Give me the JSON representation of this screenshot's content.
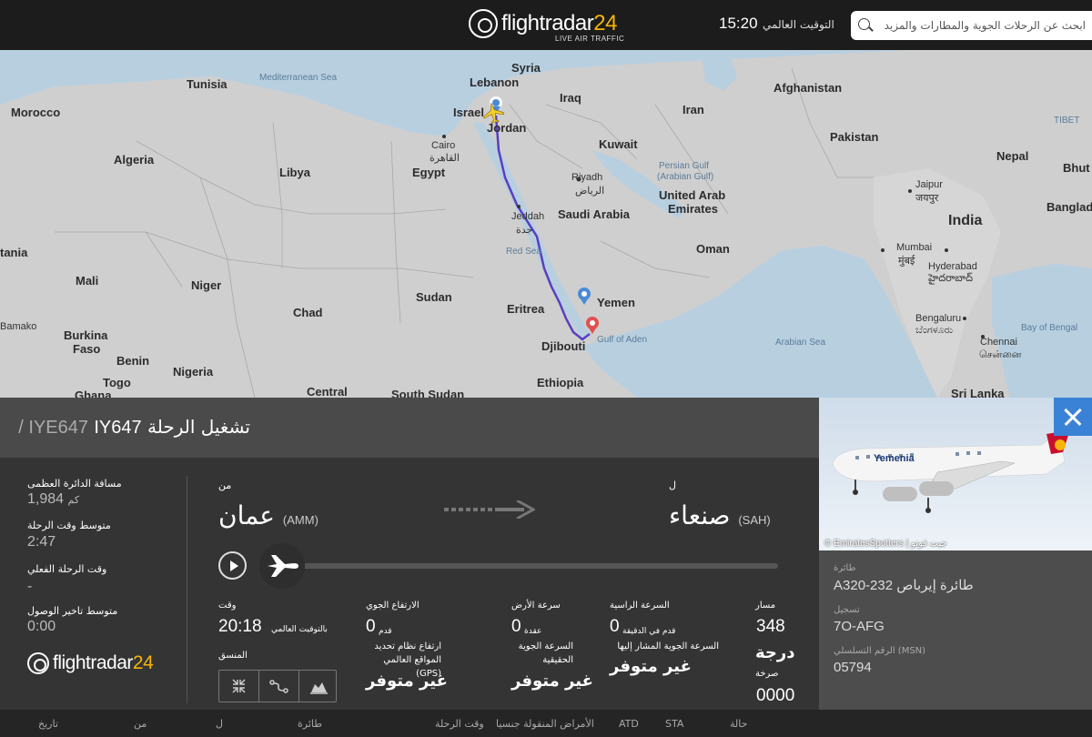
{
  "header": {
    "logo_text": "flightradar",
    "logo_num": "24",
    "logo_sub": "LIVE AIR TRAFFIC",
    "utc_label": "التوقيت العالمي",
    "utc_time": "15:20",
    "search_placeholder": "ابحث عن الرحلات الجوية والمطارات والمزيد"
  },
  "map": {
    "labels": {
      "tunisia": "Tunisia",
      "morocco": "Morocco",
      "algeria": "Algeria",
      "libya": "Libya",
      "egypt": "Egypt",
      "cairo": "Cairo",
      "cairo_ar": "القاهرة",
      "mediterranean": "Mediterranean Sea",
      "syria": "Syria",
      "lebanon": "Lebanon",
      "israel": "Israel",
      "jordan": "Jordan",
      "iraq": "Iraq",
      "iran": "Iran",
      "afghanistan": "Afghanistan",
      "pakistan": "Pakistan",
      "kuwait": "Kuwait",
      "persian_gulf": "Persian Gulf",
      "arabian_gulf": "(Arabian Gulf)",
      "riyadh": "Riyadh",
      "riyadh_ar": "الرياض",
      "saudi": "Saudi Arabia",
      "uae1": "United Arab",
      "uae2": "Emirates",
      "oman": "Oman",
      "jeddah": "Jeddah",
      "jeddah_ar": "جدة",
      "red_sea": "Red Sea",
      "yemen": "Yemen",
      "eritrea": "Eritrea",
      "djibouti": "Djibouti",
      "gulf_aden": "Gulf of Aden",
      "ethiopia": "Ethiopia",
      "sudan": "Sudan",
      "south_sudan": "South Sudan",
      "chad": "Chad",
      "niger": "Niger",
      "mali": "Mali",
      "nigeria": "Nigeria",
      "central": "Central",
      "benin": "Benin",
      "togo": "Togo",
      "ghana": "Ghana",
      "burkina1": "Burkina",
      "burkina2": "Faso",
      "bamako": "Bamako",
      "tania": "tania",
      "nepal": "Nepal",
      "bhutan": "Bhut",
      "tibet": "TIBET",
      "india": "India",
      "jaipur": "Jaipur",
      "jaipur_hi": "जयपुर",
      "mumbai": "Mumbai",
      "mumbai_mr": "मुंबई",
      "hyderabad": "Hyderabad",
      "hyderabad_te": "హైదరాబాద్",
      "bengaluru": "Bengaluru",
      "bengaluru_kn": "ಬೆಂಗಳೂರು",
      "chennai": "Chennai",
      "chennai_ta": "சென்னை",
      "bangla": "Banglad",
      "bay_bengal": "Bay of Bengal",
      "arabian_sea": "Arabian Sea",
      "sri_lanka": "Sri Lanka"
    }
  },
  "flight": {
    "title_ar": "تشغيل الرحلة",
    "code": "IY647",
    "alt_code": "/ IYE647",
    "from_label": "من",
    "from_city": "عمان",
    "from_iata": "(AMM)",
    "to_label": "ل",
    "to_city": "صنعاء",
    "to_iata": "(SAH)",
    "progress": 0.02
  },
  "stats": {
    "gc_label": "مسافة الدائرة العظمى",
    "gc_value": "1,984",
    "gc_unit": "كم",
    "avg_time_label": "متوسط وقت الرحلة",
    "avg_time_value": "2:47",
    "actual_time_label": "وقت الرحلة الفعلي",
    "actual_time_value": "-",
    "avg_delay_label": "متوسط تاخير الوصول",
    "avg_delay_value": "0:00"
  },
  "metrics": {
    "time_label": "وقت",
    "time_value": "20:18",
    "time_unit": "بالتوقيت العالمي",
    "alt_label": "الارتفاع الجوي",
    "alt_value": "0",
    "alt_unit": "قدم",
    "gps_label": "ارتفاع نظام تحديد المواقع العالمي (GPS)",
    "gps_value": "غير متوفر",
    "gs_label": "سرعة الأرض",
    "gs_value": "0",
    "gs_unit": "عقدة",
    "tas_label": "السرعة الجوية الحقيقية",
    "tas_value": "غير متوفر",
    "vs_label": "السرعة الراسية",
    "vs_value": "0",
    "vs_unit": "قدم في الدقيقة",
    "ias_label": "السرعة الجوية المشار إليها",
    "ias_value": "غير متوفر",
    "track_label": "مسار",
    "track_value": "348",
    "track_unit": "درجة",
    "squawk_label": "صرخة",
    "squawk_value": "0000",
    "graph_label": "المنسق"
  },
  "aircraft": {
    "photo_credit": "© EmiratesSpotters | جيت فوتو",
    "type_label": "طائرة",
    "type_value": "A320-232 طائرة إيرباص",
    "reg_label": "تسجيل",
    "reg_value": "7O-AFG",
    "msn_label": "الرقم التسلسلي (MSN)",
    "msn_value": "05794",
    "livery_text": "Yemenia"
  },
  "bottom_columns": {
    "date": "تاريخ",
    "from": "من",
    "to": "ل",
    "aircraft": "طائرة",
    "flight_time": "وقت الرحلة",
    "diseases": "الأمراض المنقولة جنسيا",
    "atd": "ATD",
    "sta": "STA",
    "status": "حالة"
  },
  "colors": {
    "accent": "#f5b50a",
    "route": "#5a3fc0",
    "close": "#3a82d6"
  }
}
